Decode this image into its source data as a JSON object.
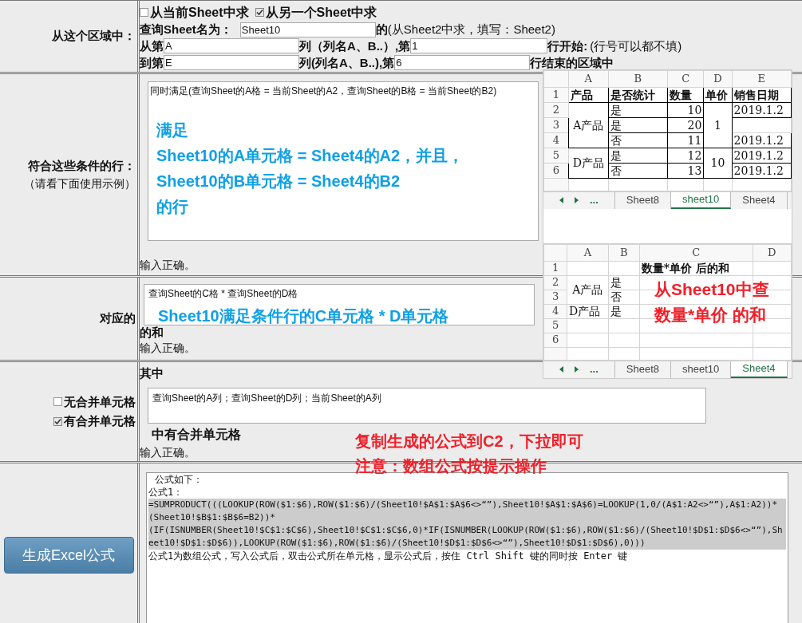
{
  "region_section": {
    "label": "从这个区域中：",
    "source_options": [
      {
        "label": "从当前Sheet中求",
        "checked": false
      },
      {
        "label": "从另一个Sheet中求",
        "checked": true
      }
    ],
    "sheet_name": {
      "label": "查询Sheet名为：",
      "value": "Sheet10",
      "hint": "**的**(从Sheet2中求，填写：Sheet2)"
    },
    "from": {
      "label": "从第",
      "column": "A",
      "column_hint": "列（列名A、B..）,第",
      "row": "1",
      "row_hint": "行开始:",
      "note": "(行号可以都不填)"
    },
    "to": {
      "label": "到第",
      "column": "E",
      "column_hint": "列(列名A、B..),第",
      "row": "6",
      "row_hint": "行结束的区域中"
    }
  },
  "conditions_section": {
    "label": "符合这些条件的行：",
    "sublabel": "（请看下面使用示例）",
    "value": "同时满足(查询Sheet的A格 = 当前Sheet的A2，查询Sheet的B格 = 当前Sheet的B2)",
    "annotation": [
      "满足",
      "Sheet10的A单元格 = Sheet4的A2，并且，",
      "Sheet10的B单元格 = Sheet4的B2",
      "的行"
    ],
    "status": "输入正确。"
  },
  "sum_section": {
    "label": "对应的",
    "value": "查询Sheet的C格 * 查询Sheet的D格",
    "annotation": "Sheet10满足条件行的C单元格 * D单元格",
    "suffix": "的和",
    "status": "输入正确。"
  },
  "merge_section": {
    "options": [
      {
        "label": "无合并单元格",
        "checked": false
      },
      {
        "label": "有合并单元格",
        "checked": true
      }
    ],
    "heading": "其中",
    "value": "查询Sheet的A列；查询Sheet的D列；当前Sheet的A列",
    "suffix": "中有合并单元格",
    "status": "输入正确。",
    "annotation": [
      "复制生成的公式到C2，下拉即可",
      "注意：数组公式按提示操作"
    ]
  },
  "generate_section": {
    "button": "生成Excel公式",
    "output": [
      {
        "kind": "text",
        "text": "公式如下："
      },
      {
        "kind": "text",
        "text": "公式1："
      },
      {
        "kind": "formula",
        "text": "=SUMPRODUCT(((LOOKUP(ROW($1:$6),ROW($1:$6)/(Sheet10!$A$1:$A$6<>“”),Sheet10!$A$1:$A$6)=LOOKUP(1,0/(A$1:A2<>“”),A$1:A2))*(Sheet10!$B$1:$B$6=B2))*"
      },
      {
        "kind": "formula",
        "text": "(IF(ISNUMBER(Sheet10!$C$1:$C$6),Sheet10!$C$1:$C$6,0)*IF(ISNUMBER(LOOKUP(ROW($1:$6),ROW($1:$6)/(Sheet10!$D$1:$D$6<>“”),Sheet10!$D$1:$D$6)),LOOKUP(ROW($1:$6),ROW($1:$6)/(Sheet10!$D$1:$D$6<>“”),Sheet10!$D$1:$D$6),0)))"
      },
      {
        "kind": "text",
        "text": "公式1为数组公式，写入公式后，双击公式所在单元格，显示公式后，按住 Ctrl Shift 键的同时按 Enter 键"
      }
    ]
  },
  "spreadsheets": [
    {
      "table_borders": true,
      "columns": [
        "A",
        "B",
        "C",
        "D",
        "E"
      ],
      "rows": [
        {
          "number": "1",
          "kind": "header",
          "cells": [
            {
              "text": "产品"
            },
            {
              "text": "是否统计"
            },
            {
              "text": "数量"
            },
            {
              "text": "单价"
            },
            {
              "text": "销售日期"
            }
          ]
        },
        {
          "number": "2",
          "cells": [
            {
              "text": "A产品",
              "rowspan": 3
            },
            {
              "text": "是"
            },
            {
              "text": "10",
              "kind": "number"
            },
            {
              "text": "1",
              "rowspan": 3
            },
            {
              "text": "2019.1.2"
            }
          ]
        },
        {
          "number": "3",
          "cells": [
            {
              "text": "是"
            },
            {
              "text": "20",
              "kind": "number"
            },
            {}
          ]
        },
        {
          "number": "4",
          "cells": [
            {
              "text": "否"
            },
            {
              "text": "11",
              "kind": "number"
            },
            {
              "text": "2019.1.2"
            }
          ]
        },
        {
          "number": "5",
          "cells": [
            {
              "text": "D产品",
              "rowspan": 2
            },
            {
              "text": "是"
            },
            {
              "text": "12",
              "kind": "number"
            },
            {
              "text": "10",
              "rowspan": 2
            },
            {
              "text": "2019.1.2"
            }
          ]
        },
        {
          "number": "6",
          "cells": [
            {
              "text": "否"
            },
            {
              "text": "13",
              "kind": "number"
            },
            {
              "text": "2019.1.2"
            }
          ]
        }
      ],
      "more": "...",
      "tabs": [
        {
          "label": "Sheet8",
          "selected": false
        },
        {
          "label": "sheet10",
          "selected": true
        },
        {
          "label": "Sheet4",
          "selected": false
        }
      ]
    },
    {
      "table_borders": false,
      "columns": [
        "A",
        "B",
        "C",
        "D"
      ],
      "rows": [
        {
          "number": "1",
          "kind": "header",
          "cells": [
            {},
            {},
            {
              "text": "数量*单价 后的和"
            },
            {}
          ]
        },
        {
          "number": "2",
          "cells": [
            {
              "text": "A产品",
              "rowspan": 2
            },
            {
              "text": "是"
            },
            {},
            {}
          ]
        },
        {
          "number": "3",
          "cells": [
            {
              "text": "否"
            },
            {},
            {}
          ]
        },
        {
          "number": "4",
          "cells": [
            {
              "text": "D产品"
            },
            {
              "text": "是"
            },
            {},
            {}
          ]
        },
        {
          "number": "5",
          "cells": [
            {},
            {},
            {},
            {}
          ]
        },
        {
          "number": "6",
          "cells": [
            {},
            {},
            {},
            {}
          ]
        }
      ],
      "annotation": [
        "从Sheet10中查",
        "数量*单价 的和"
      ],
      "more": "...",
      "tabs": [
        {
          "label": "Sheet8",
          "selected": false
        },
        {
          "label": "sheet10",
          "selected": false
        },
        {
          "label": "Sheet4",
          "selected": true
        }
      ]
    }
  ]
}
